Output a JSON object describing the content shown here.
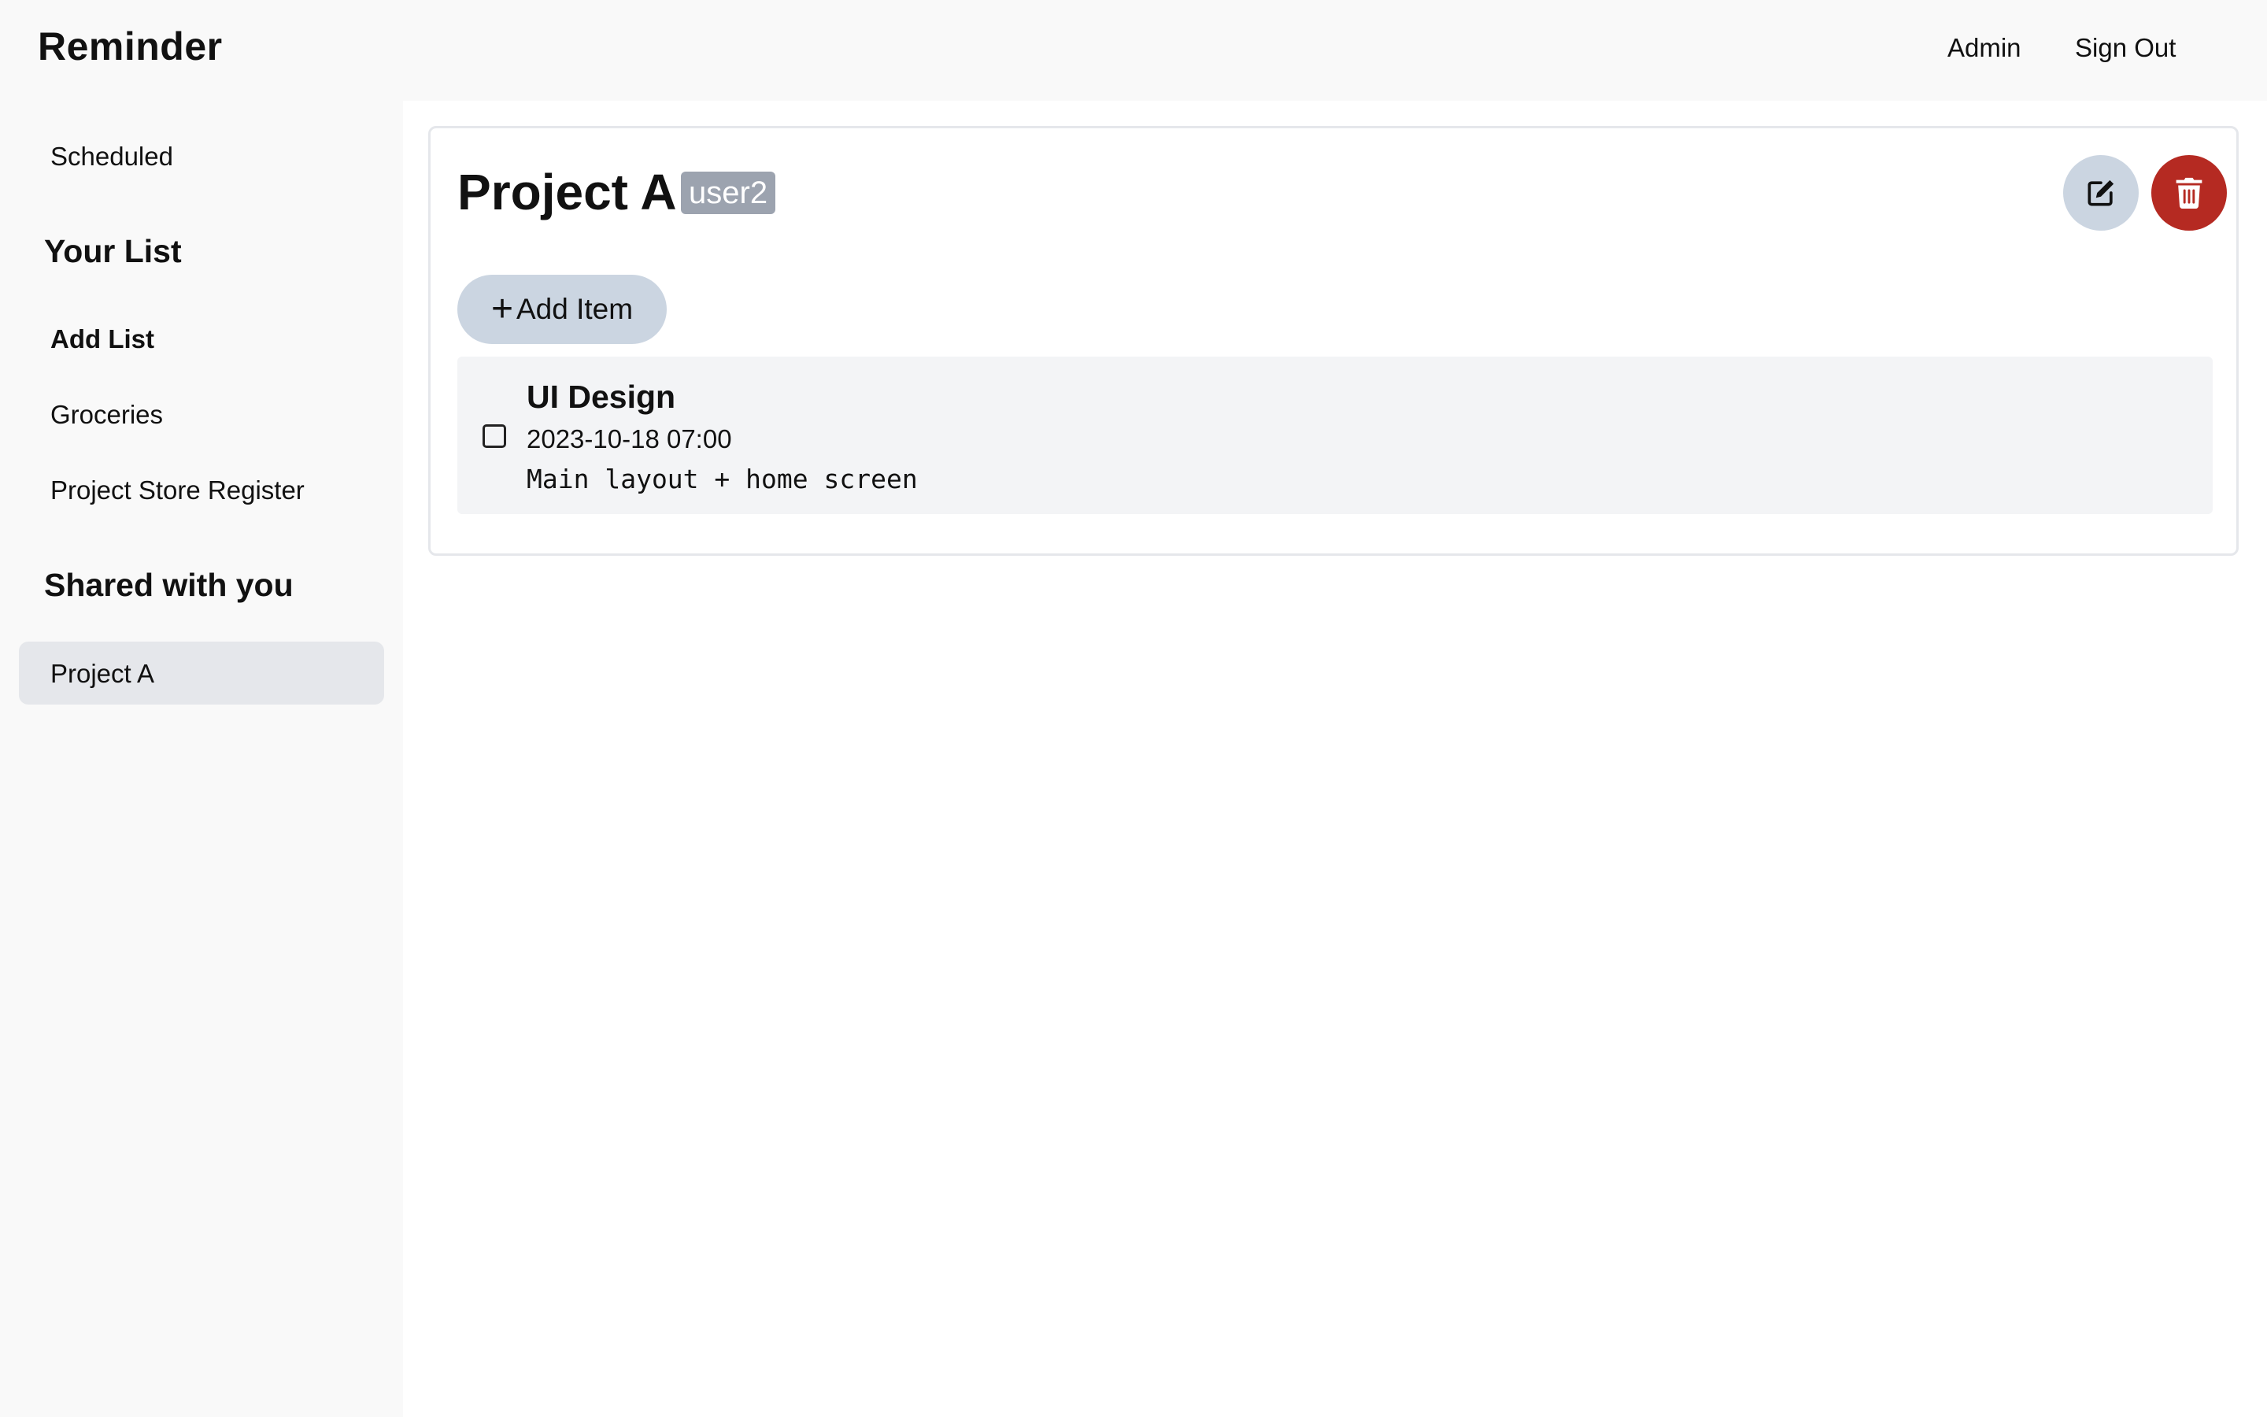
{
  "app": {
    "brand": "Reminder"
  },
  "header": {
    "admin_label": "Admin",
    "signout_label": "Sign Out"
  },
  "sidebar": {
    "scheduled_label": "Scheduled",
    "your_list_heading": "Your List",
    "add_list_label": "Add List",
    "lists": [
      {
        "label": "Groceries"
      },
      {
        "label": "Project Store Register"
      }
    ],
    "shared_heading": "Shared with you",
    "shared_lists": [
      {
        "label": "Project A",
        "active": true
      }
    ]
  },
  "main": {
    "list_title": "Project A",
    "owner_badge": "user2",
    "edit_icon": "edit-icon",
    "delete_icon": "trash-icon",
    "add_item_label": "Add Item",
    "items": [
      {
        "title": "UI Design",
        "date": "2023-10-18",
        "time": "07:00",
        "datetime": "2023-10-18 07:00",
        "notes": "Main layout + home screen",
        "completed": false
      }
    ]
  },
  "colors": {
    "delete_button": "#b52a22",
    "edit_button": "#cbd5e1",
    "active_sidebar": "#e5e7eb",
    "badge": "#9ca3af"
  }
}
